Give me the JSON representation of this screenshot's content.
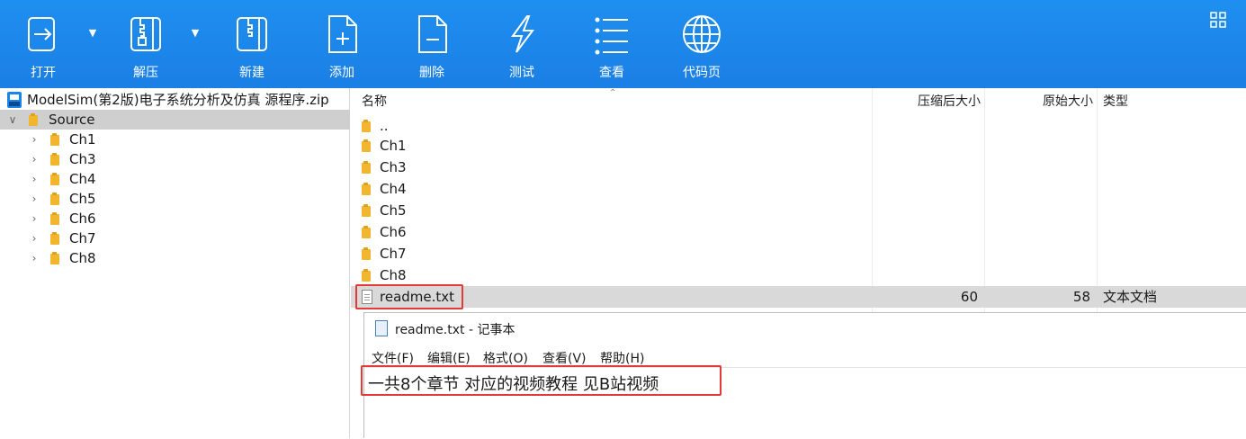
{
  "toolbar": {
    "buttons": [
      {
        "label": "打开",
        "icon": "open-icon"
      },
      {
        "label": "解压",
        "icon": "extract-icon"
      },
      {
        "label": "新建",
        "icon": "new-archive-icon"
      },
      {
        "label": "添加",
        "icon": "add-file-icon"
      },
      {
        "label": "删除",
        "icon": "delete-file-icon"
      },
      {
        "label": "测试",
        "icon": "lightning-icon"
      },
      {
        "label": "查看",
        "icon": "list-view-icon"
      },
      {
        "label": "代码页",
        "icon": "globe-icon"
      }
    ],
    "corner_icon": "grid-icon",
    "accent": "#1b84ea"
  },
  "tree": {
    "archive": "ModelSim(第2版)电子系统分析及仿真 源程序.zip",
    "root": "Source",
    "children": [
      "Ch1",
      "Ch3",
      "Ch4",
      "Ch5",
      "Ch6",
      "Ch7",
      "Ch8"
    ]
  },
  "list": {
    "columns": {
      "name": "名称",
      "compressed": "压缩后大小",
      "original": "原始大小",
      "type": "类型"
    },
    "rows": [
      {
        "name": "..",
        "compressed": "",
        "original": "",
        "type": ""
      },
      {
        "name": "Ch1",
        "compressed": "",
        "original": "",
        "type": ""
      },
      {
        "name": "Ch3",
        "compressed": "",
        "original": "",
        "type": ""
      },
      {
        "name": "Ch4",
        "compressed": "",
        "original": "",
        "type": ""
      },
      {
        "name": "Ch5",
        "compressed": "",
        "original": "",
        "type": ""
      },
      {
        "name": "Ch6",
        "compressed": "",
        "original": "",
        "type": ""
      },
      {
        "name": "Ch7",
        "compressed": "",
        "original": "",
        "type": ""
      },
      {
        "name": "Ch8",
        "compressed": "",
        "original": "",
        "type": ""
      },
      {
        "name": "readme.txt",
        "compressed": "60",
        "original": "58",
        "type": "文本文档"
      }
    ],
    "highlight_color": "#e53935"
  },
  "notepad": {
    "title": "readme.txt - 记事本",
    "menu": [
      "文件(F)",
      "编辑(E)",
      "格式(O)",
      "查看(V)",
      "帮助(H)"
    ],
    "content": "一共8个章节  对应的视频教程  见B站视频"
  }
}
